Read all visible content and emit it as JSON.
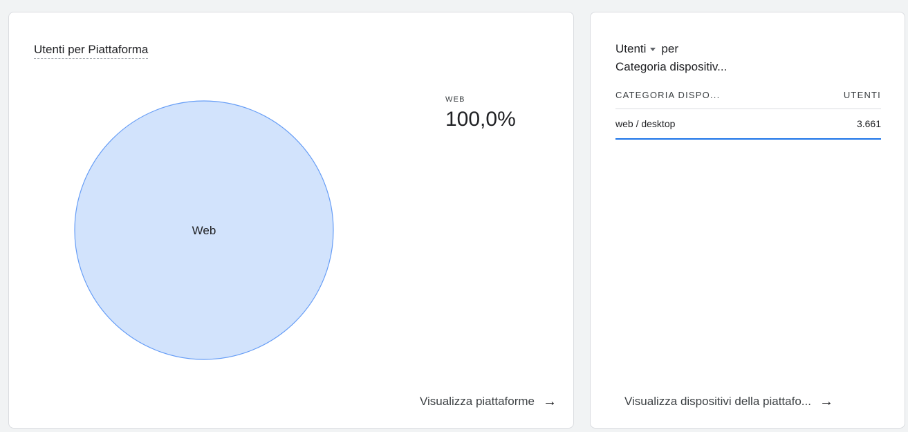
{
  "left_card": {
    "title": "Utenti per Piattaforma",
    "legend": {
      "label": "WEB",
      "value": "100,0%"
    },
    "link_label": "Visualizza piattaforme"
  },
  "chart_data": {
    "type": "pie",
    "categories": [
      "Web"
    ],
    "values": [
      100.0
    ],
    "colors": {
      "fill": "#d2e3fc",
      "stroke": "#669df6"
    }
  },
  "right_card": {
    "title_metric": "Utenti",
    "title_per": "per",
    "title_dimension": "Categoria dispositiv...",
    "table": {
      "headers": [
        "CATEGORIA DISPO...",
        "UTENTI"
      ],
      "rows": [
        {
          "category": "web / desktop",
          "users": "3.661"
        }
      ]
    },
    "link_label": "Visualizza dispositivi della piattafo..."
  },
  "icons": {
    "link_arrow": "arrow-right-icon",
    "metric_dropdown": "dropdown-icon"
  },
  "colors": {
    "accent": "#1a73e8",
    "card_border": "#dadce0",
    "background": "#f1f3f4"
  }
}
